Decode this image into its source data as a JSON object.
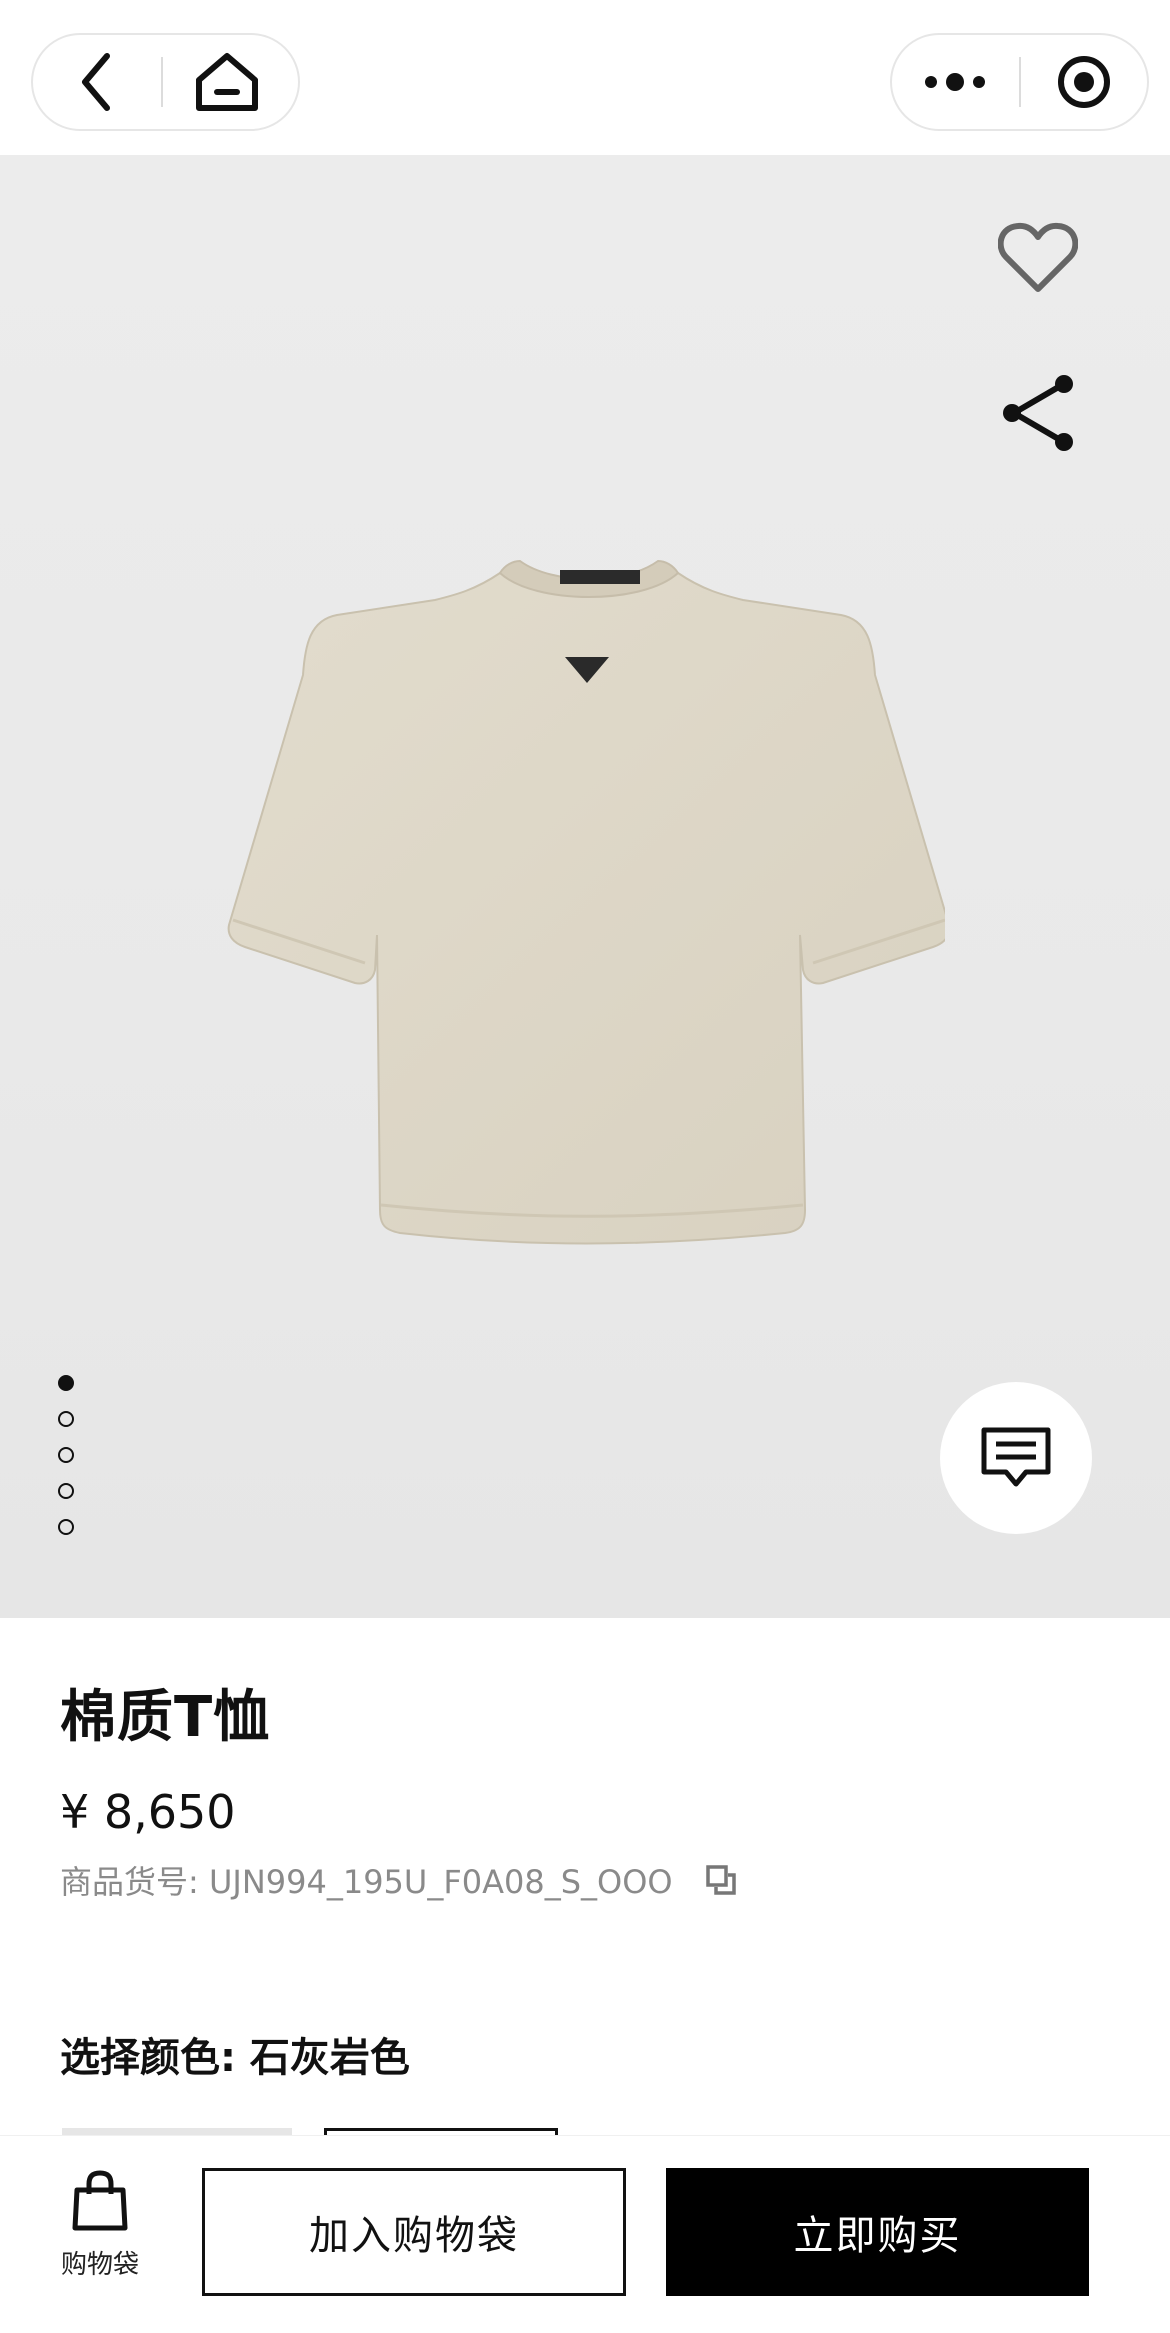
{
  "nav": {
    "back_icon": "chevron-left-icon",
    "home_icon": "home-icon",
    "more_icon": "more-dots-icon",
    "close_icon": "target-close-icon"
  },
  "hero": {
    "image": "beige cotton t-shirt with triangle logo",
    "favorite_icon": "heart-icon",
    "share_icon": "share-icon",
    "chat_icon": "chat-bubble-icon",
    "carousel_total": 5,
    "carousel_active": 1
  },
  "product": {
    "title": "棉质T恤",
    "price": "¥ 8,650",
    "sku_label": "商品货号: UJN994_195U_F0A08_S_OOO",
    "copy_icon": "copy-icon",
    "color_label": "选择颜色: 石灰岩色"
  },
  "bottom": {
    "bag_label": "购物袋",
    "bag_icon": "shopping-bag-icon",
    "add_to_bag": "加入购物袋",
    "buy_now": "立即购买"
  },
  "colors": {
    "background": "#ececec",
    "shirt": "#ddd6c6",
    "primary": "#000000"
  }
}
